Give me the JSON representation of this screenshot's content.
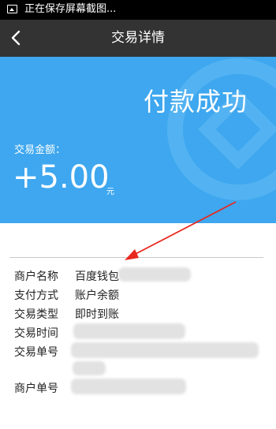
{
  "status_bar": {
    "text": "正在保存屏幕截图..."
  },
  "header": {
    "title": "交易详情"
  },
  "payment": {
    "status": "付款成功",
    "amount_label": "交易金额：",
    "amount": "+5.00",
    "currency_unit": "元"
  },
  "details": {
    "merchant_name_label": "商户名称",
    "merchant_name_value": "百度钱包",
    "payment_method_label": "支付方式",
    "payment_method_value": "账户余额",
    "transaction_type_label": "交易类型",
    "transaction_type_value": "即时到账",
    "transaction_time_label": "交易时间",
    "transaction_number_label": "交易单号",
    "merchant_number_label": "商户单号"
  },
  "colors": {
    "hero_blue": "#3ea7ef",
    "header_gray": "#333333",
    "arrow_red": "#e8281e"
  }
}
